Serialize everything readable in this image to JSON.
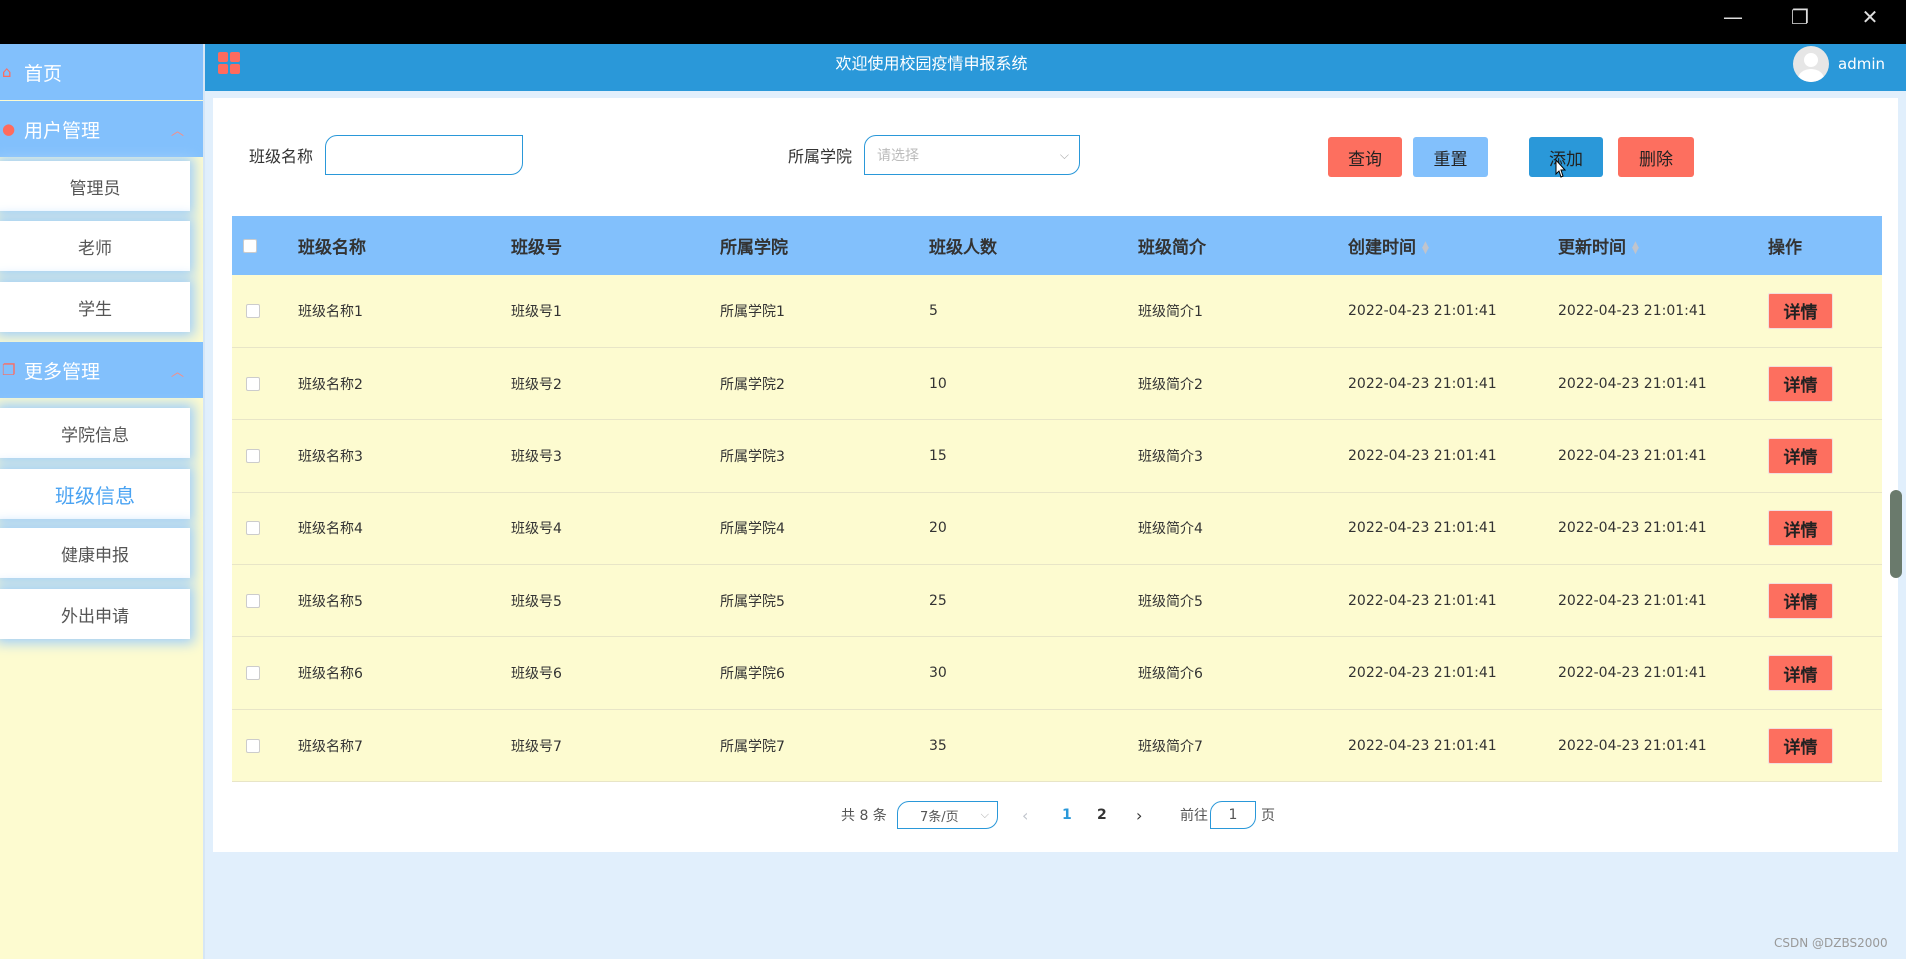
{
  "window": {
    "minimize": "—",
    "restore": "❐",
    "close": "✕"
  },
  "sidebar": {
    "home": "首页",
    "groups": [
      {
        "label": "用户管理",
        "items": [
          "管理员",
          "老师",
          "学生"
        ]
      },
      {
        "label": "更多管理",
        "items": [
          "学院信息",
          "班级信息",
          "健康申报",
          "外出申请"
        ]
      }
    ],
    "active_item": "班级信息"
  },
  "header": {
    "title": "欢迎使用校园疫情申报系统",
    "user": "admin"
  },
  "search": {
    "class_name_label": "班级名称",
    "class_name_value": "",
    "college_label": "所属学院",
    "college_placeholder": "请选择"
  },
  "buttons": {
    "query": "查询",
    "reset": "重置",
    "add": "添加",
    "delete": "删除"
  },
  "table": {
    "columns": [
      "班级名称",
      "班级号",
      "所属学院",
      "班级人数",
      "班级简介",
      "创建时间",
      "更新时间",
      "操作"
    ],
    "detail_label": "详情",
    "rows": [
      [
        "班级名称1",
        "班级号1",
        "所属学院1",
        "5",
        "班级简介1",
        "2022-04-23 21:01:41",
        "2022-04-23 21:01:41"
      ],
      [
        "班级名称2",
        "班级号2",
        "所属学院2",
        "10",
        "班级简介2",
        "2022-04-23 21:01:41",
        "2022-04-23 21:01:41"
      ],
      [
        "班级名称3",
        "班级号3",
        "所属学院3",
        "15",
        "班级简介3",
        "2022-04-23 21:01:41",
        "2022-04-23 21:01:41"
      ],
      [
        "班级名称4",
        "班级号4",
        "所属学院4",
        "20",
        "班级简介4",
        "2022-04-23 21:01:41",
        "2022-04-23 21:01:41"
      ],
      [
        "班级名称5",
        "班级号5",
        "所属学院5",
        "25",
        "班级简介5",
        "2022-04-23 21:01:41",
        "2022-04-23 21:01:41"
      ],
      [
        "班级名称6",
        "班级号6",
        "所属学院6",
        "30",
        "班级简介6",
        "2022-04-23 21:01:41",
        "2022-04-23 21:01:41"
      ],
      [
        "班级名称7",
        "班级号7",
        "所属学院7",
        "35",
        "班级简介7",
        "2022-04-23 21:01:41",
        "2022-04-23 21:01:41"
      ]
    ]
  },
  "pagination": {
    "total": "共 8 条",
    "page_size": "7条/页",
    "pages": [
      "1",
      "2"
    ],
    "current_page": "1",
    "goto_label": "前往",
    "goto_value": "1",
    "page_suffix": "页"
  },
  "watermark": "CSDN @DZBS2000",
  "colors": {
    "primary_blue": "#2a98d9",
    "light_blue": "#82c0fc",
    "red": "#fd6f5f",
    "cream": "#fdfbd0"
  }
}
